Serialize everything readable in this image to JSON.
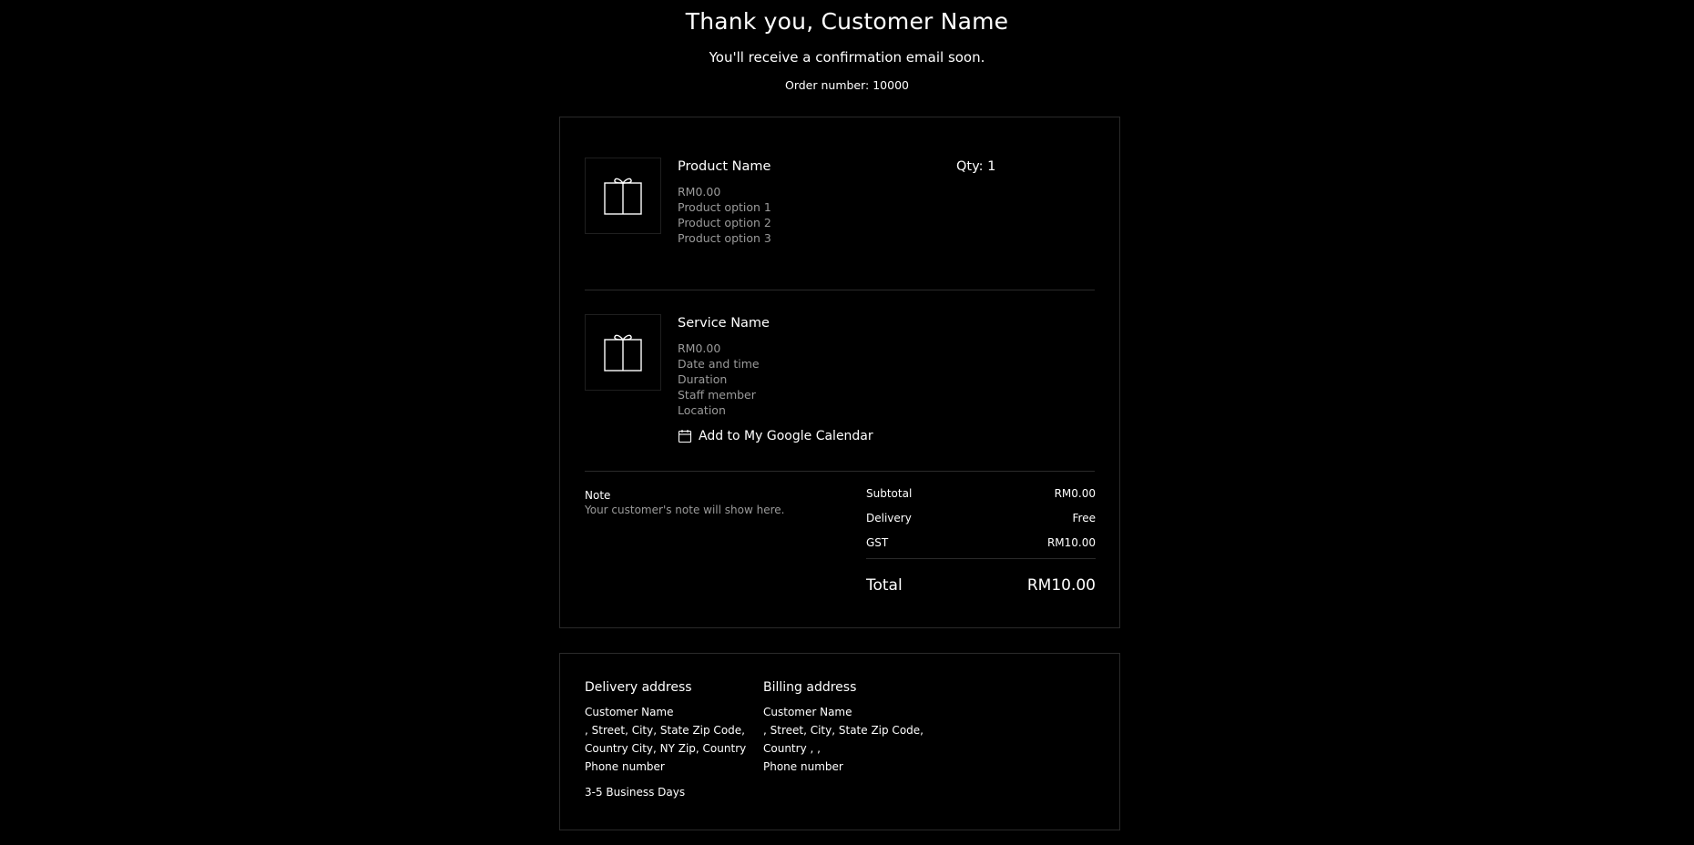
{
  "header": {
    "title": "Thank you, Customer Name",
    "subtitle": "You'll receive a confirmation email soon.",
    "order_number": "Order number: 10000"
  },
  "items": [
    {
      "name": "Product Name",
      "icon": "gift-icon",
      "quantity": "Qty: 1",
      "details": [
        "RM0.00",
        "Product option 1",
        "Product option 2",
        "Product option 3"
      ]
    },
    {
      "name": "Service Name",
      "icon": "gift-icon",
      "details": [
        "RM0.00",
        "Date and time",
        "Duration",
        "Staff member",
        "Location"
      ],
      "calendar_action": "Add to My Google Calendar"
    }
  ],
  "note": {
    "label": "Note",
    "text": "Your customer's note will show here."
  },
  "totals": {
    "subtotal_label": "Subtotal",
    "subtotal_value": "RM0.00",
    "delivery_label": "Delivery",
    "delivery_value": "Free",
    "gst_label": "GST",
    "gst_value": "RM10.00",
    "total_label": "Total",
    "total_value": "RM10.00"
  },
  "delivery_address": {
    "title": "Delivery address",
    "lines": [
      "Customer Name",
      ", Street, City, State Zip Code,",
      "Country City, NY Zip, Country",
      "Phone number"
    ],
    "shipping_time": "3-5 Business Days"
  },
  "billing_address": {
    "title": "Billing address",
    "lines": [
      "Customer Name",
      ", Street, City, State Zip Code,",
      "Country , ,",
      "Phone number"
    ]
  },
  "colors": {
    "background": "#000000",
    "text": "#ffffff",
    "muted_text": "#9a9a9a",
    "border": "#2a2a2a"
  }
}
